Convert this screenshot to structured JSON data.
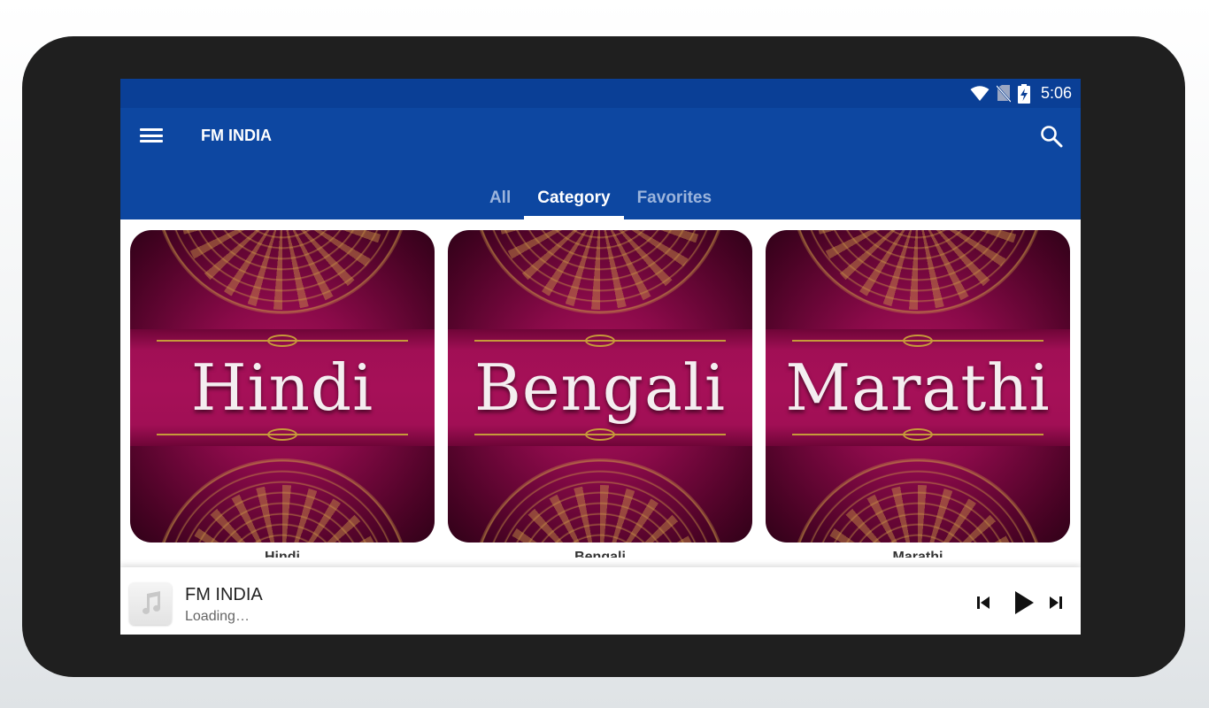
{
  "status_bar": {
    "time": "5:06",
    "icons": [
      "wifi-icon",
      "no-sim-icon",
      "battery-charging-icon"
    ]
  },
  "appbar": {
    "title": "FM INDIA",
    "menu_icon": "menu-icon",
    "search_icon": "search-icon"
  },
  "tabs": [
    {
      "label": "All",
      "active": false
    },
    {
      "label": "Category",
      "active": true
    },
    {
      "label": "Favorites",
      "active": false
    }
  ],
  "categories": [
    {
      "image_text": "Hindi",
      "caption": "Hindi"
    },
    {
      "image_text": "Bengali",
      "caption": "Bengali"
    },
    {
      "image_text": "Marathi",
      "caption": "Marathi"
    }
  ],
  "player": {
    "title": "FM INDIA",
    "status": "Loading…",
    "thumb_icon": "music-note-icon",
    "controls": [
      "previous-icon",
      "play-icon",
      "next-icon"
    ]
  },
  "colors": {
    "status_bar": "#0a3f96",
    "appbar": "#0d47a1",
    "tab_inactive": "#9bb4dc",
    "card_banner": "#a61058",
    "gold": "#c69a3a"
  }
}
